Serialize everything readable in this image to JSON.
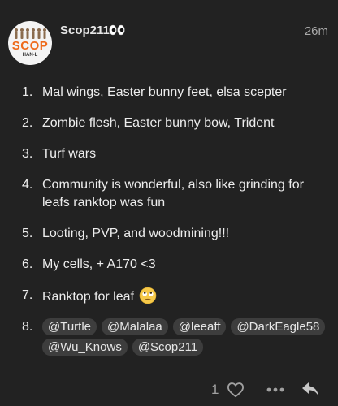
{
  "post": {
    "avatar": {
      "label": "SCOP",
      "sub": "HAN-L"
    },
    "username": "Scop211",
    "time": "26m",
    "icons": {
      "status": "eyes-emoji",
      "reaction": "face-with-rolling-eyes-emoji"
    }
  },
  "answers": [
    {
      "num": "1.",
      "text": "Mal wings, Easter bunny feet, elsa scepter"
    },
    {
      "num": "2.",
      "text": "Zombie flesh, Easter bunny bow, Trident"
    },
    {
      "num": "3.",
      "text": "Turf wars"
    },
    {
      "num": "4.",
      "text": "Community is wonderful, also like grinding for leafs ranktop was fun"
    },
    {
      "num": "5.",
      "text": "Looting, PVP, and woodmining!!!"
    },
    {
      "num": "6.",
      "text": "My cells, + A170 <3"
    },
    {
      "num": "7.",
      "text": "Ranktop for leaf"
    },
    {
      "num": "8.",
      "mentions": [
        "@Turtle",
        "@Malalaa",
        "@leeaff",
        "@DarkEagle58",
        "@Wu_Knows",
        "@Scop211"
      ]
    }
  ],
  "actions": {
    "like_count": "1",
    "icons": [
      "heart-icon",
      "more-icon",
      "reply-icon"
    ]
  },
  "colors": {
    "background": "#222222",
    "text": "#ededed",
    "muted": "#a9a9a9",
    "mention_bg": "#3d3d3d",
    "brand": "#ee6a1a"
  }
}
